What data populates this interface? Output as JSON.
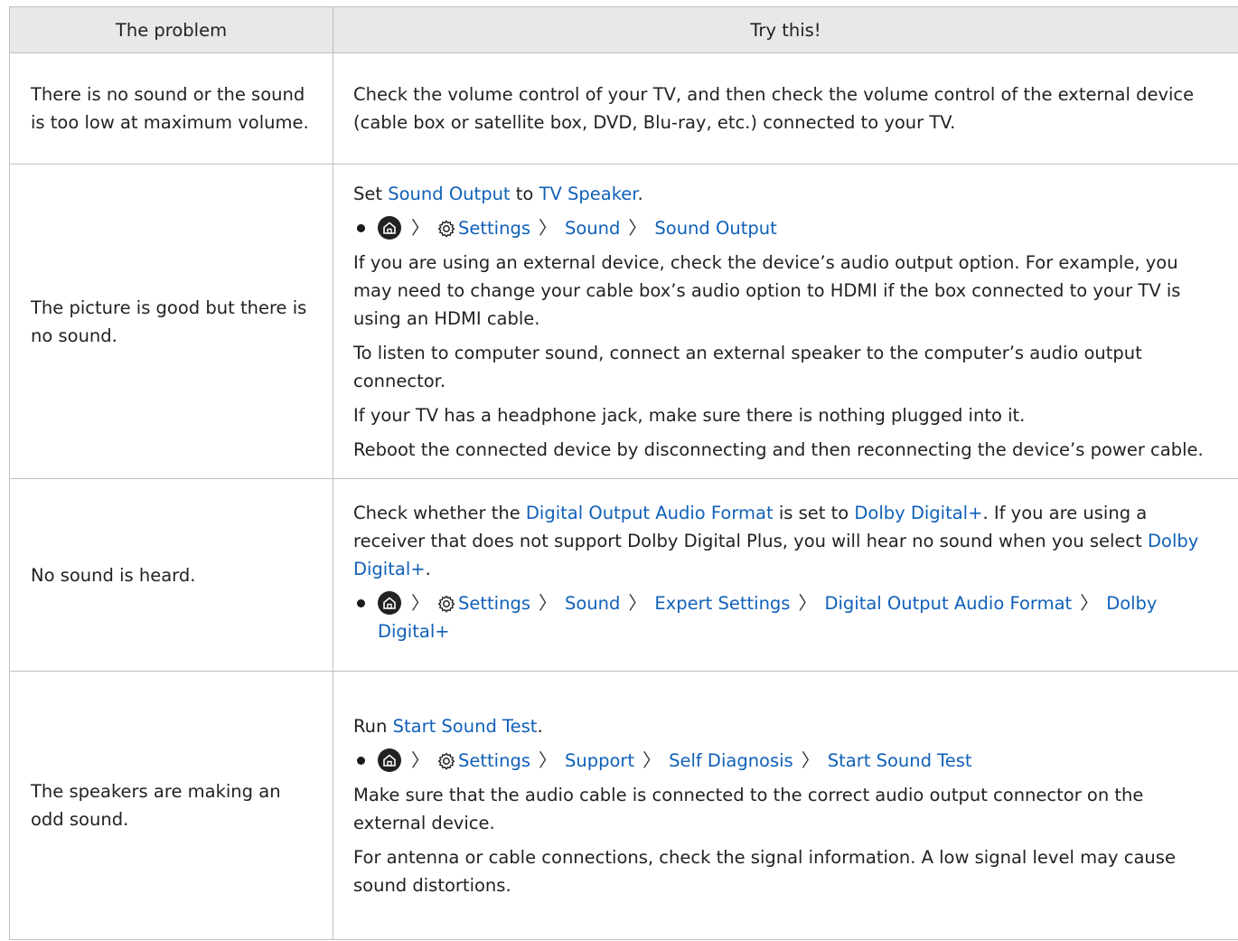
{
  "header": {
    "col_problem": "The problem",
    "col_try": "Try this!"
  },
  "rows": [
    {
      "problem": "There is no sound or the sound is too low at maximum volume.",
      "text1": "Check the volume control of your TV, and then check the volume control of the external device (cable box or satellite box, DVD, Blu-ray, etc.) connected to your TV."
    },
    {
      "problem": "The picture is good but there is no sound.",
      "set_prefix": "Set ",
      "set_link1": "Sound Output",
      "set_mid": " to ",
      "set_link2": "TV Speaker",
      "set_suffix": ".",
      "path": [
        "Settings",
        "Sound",
        "Sound Output"
      ],
      "para1": "If you are using an external device, check the device’s audio output option. For example, you may need to change your cable box’s audio option to HDMI if the box connected to your TV is using an HDMI cable.",
      "para2": "To listen to computer sound, connect an external speaker to the computer’s audio output connector.",
      "para3": "If your TV has a headphone jack, make sure there is nothing plugged into it.",
      "para4": "Reboot the connected device by disconnecting and then reconnecting the device’s power cable."
    },
    {
      "problem": "No sound is heard.",
      "t1": "Check whether the ",
      "l1": "Digital Output Audio Format",
      "t2": " is set to ",
      "l2": "Dolby Digital+",
      "t3": ". If you are using a receiver that does not support Dolby Digital Plus, you will hear no sound when you select ",
      "l3": "Dolby Digital+",
      "t4": ".",
      "path": [
        "Settings",
        "Sound",
        "Expert Settings",
        "Digital Output Audio Format",
        "Dolby Digital+"
      ]
    },
    {
      "problem": "The speakers are making an odd sound.",
      "run_prefix": "Run ",
      "run_link": "Start Sound Test",
      "run_suffix": ".",
      "path": [
        "Settings",
        "Support",
        "Self Diagnosis",
        "Start Sound Test"
      ],
      "para1": "Make sure that the audio cable is connected to the correct audio output connector on the external device.",
      "para2": "For antenna or cable connections, check the signal information. A low signal level may cause sound distortions."
    }
  ],
  "icons": {
    "home": "home-icon",
    "settings": "gear-icon",
    "separator": "chevron-right-icon"
  },
  "colors": {
    "link": "#1060b8",
    "header_bg": "#e8e8e8",
    "border": "#bfbfbf"
  }
}
